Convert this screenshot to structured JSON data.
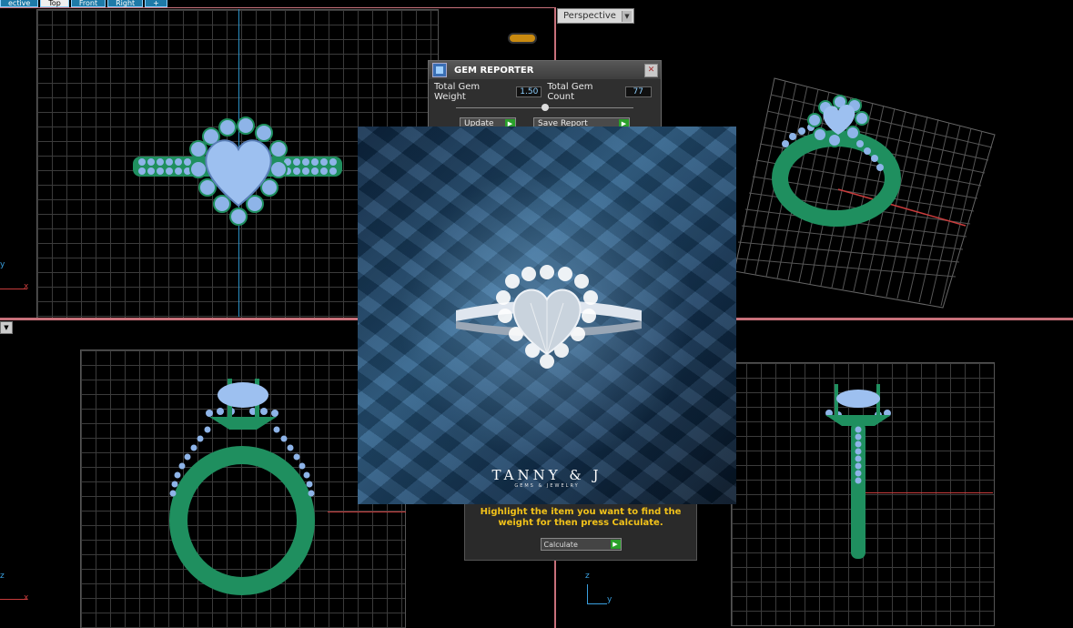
{
  "viewport_tabs": [
    "ective",
    "Top",
    "Front",
    "Right",
    "+"
  ],
  "perspective_tab": {
    "label": "Perspective"
  },
  "axis_labels": {
    "top_left_y": "y",
    "top_left_x": "x",
    "bottom_left_z": "z",
    "bottom_left_x": "x",
    "bottom_right_z": "z",
    "bottom_right_y": "y"
  },
  "gem_reporter": {
    "title": "GEM REPORTER",
    "weight_label": "Total Gem Weight",
    "weight_value": "1.50",
    "count_label": "Total Gem Count",
    "count_value": "77",
    "update_label": "Update",
    "save_label": "Save Report"
  },
  "calculate_panel": {
    "instruction": "Highlight the item you want to find the weight for then press Calculate.",
    "calculate_label": "Calculate"
  },
  "photo": {
    "brand": "TANNY & J",
    "tagline": "GEMS & JEWELRY"
  },
  "colors": {
    "metal": "#1f8f5f",
    "gem": "#8eb4e8",
    "grid": "#3b3b3b",
    "divider": "#c8707a",
    "accent_text": "#f2c21a"
  }
}
